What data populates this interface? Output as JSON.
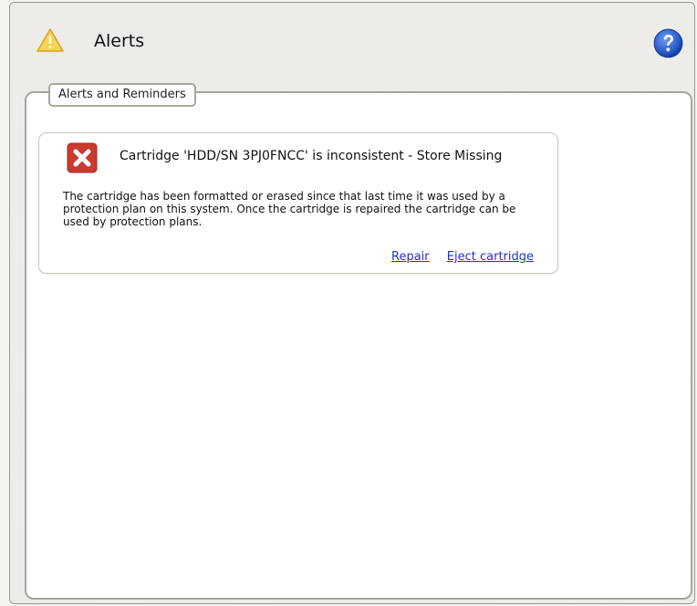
{
  "header": {
    "title": "Alerts",
    "icon": "warning-triangle-icon",
    "help_icon": "help-question-icon"
  },
  "panel": {
    "legend": "Alerts and Reminders"
  },
  "alerts": [
    {
      "icon": "error-x-icon",
      "title": "Cartridge 'HDD/SN 3PJ0FNCC' is inconsistent - Store Missing",
      "message": "The cartridge has been formatted or erased since that last time it was used by a protection plan on this system. Once the cartridge is repaired the cartridge can be used by protection plans.",
      "actions": {
        "repair": "Repair",
        "eject": "Eject cartridge"
      }
    }
  ],
  "colors": {
    "error": "#c93a2f",
    "warning": "#f0c43c",
    "help": "#2c5fcf",
    "link": "#1a37c9"
  }
}
